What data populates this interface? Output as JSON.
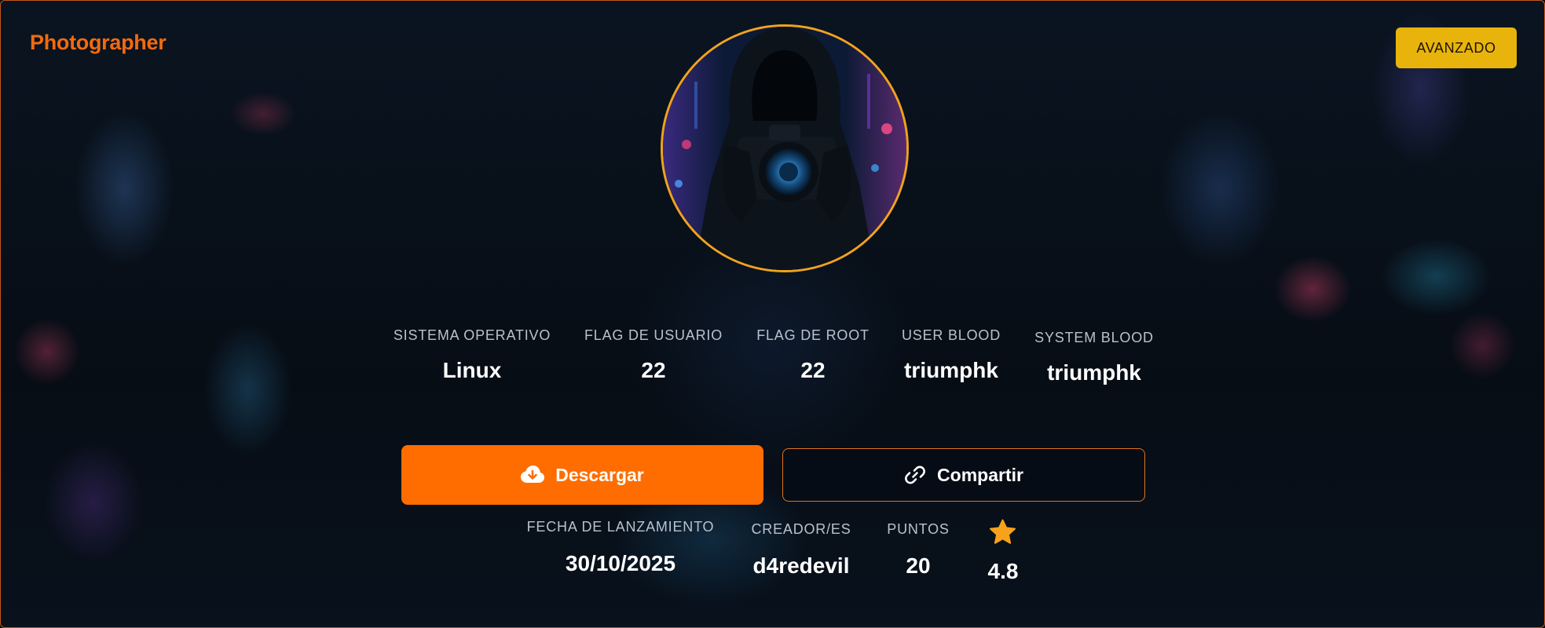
{
  "header": {
    "title": "Photographer",
    "difficulty": "AVANZADO"
  },
  "avatar": {
    "alt": "hooded-photographer-image"
  },
  "stats": [
    {
      "label": "SISTEMA OPERATIVO",
      "value": "Linux"
    },
    {
      "label": "FLAG DE USUARIO",
      "value": "22"
    },
    {
      "label": "FLAG DE ROOT",
      "value": "22"
    },
    {
      "label": "USER BLOOD",
      "value": "triumphk"
    },
    {
      "label": "SYSTEM BLOOD",
      "value": "triumphk"
    }
  ],
  "actions": {
    "download_label": "Descargar",
    "share_label": "Compartir",
    "download_icon": "cloud-download-icon",
    "share_icon": "link-icon"
  },
  "meta": [
    {
      "label": "FECHA DE LANZAMIENTO",
      "value": "30/10/2025"
    },
    {
      "label": "CREADOR/ES",
      "value": "d4redevil"
    },
    {
      "label": "PUNTOS",
      "value": "20"
    }
  ],
  "rating": {
    "value": "4.8",
    "icon": "star-icon"
  },
  "colors": {
    "accent": "#ff6d00",
    "title": "#f26a0f",
    "badge": "#e8b40c",
    "avatar_border": "#f2a21e"
  }
}
